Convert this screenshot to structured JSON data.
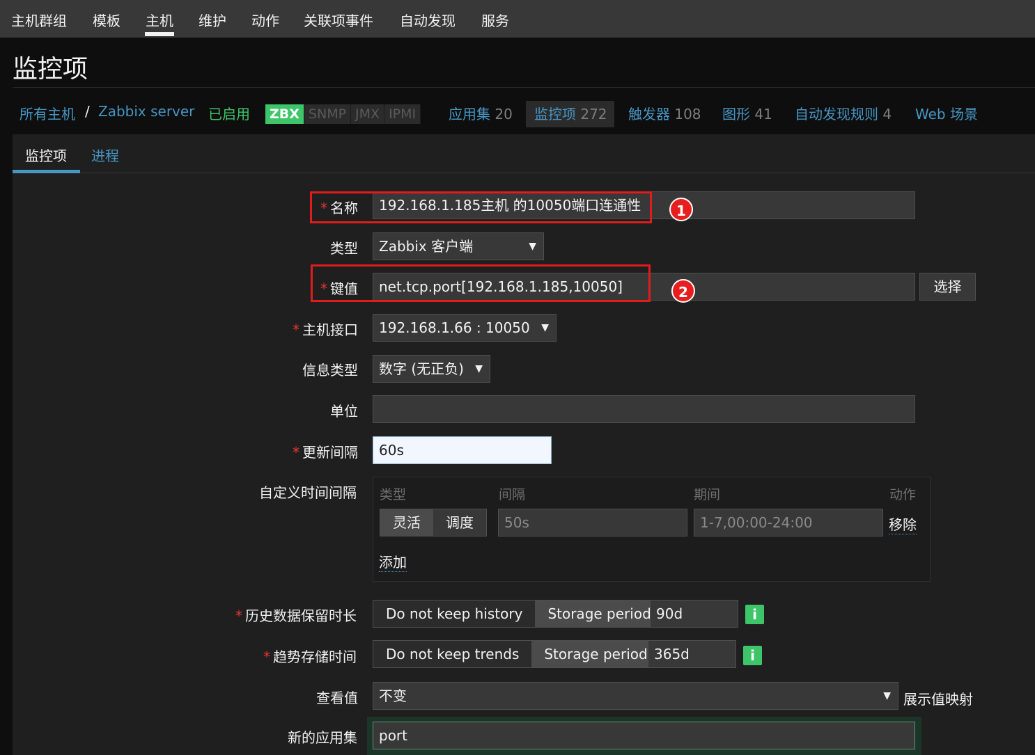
{
  "nav": {
    "items": [
      "主机群组",
      "模板",
      "主机",
      "维护",
      "动作",
      "关联项事件",
      "自动发现",
      "服务"
    ]
  },
  "page_title": "监控项",
  "breadcrumb": {
    "all_hosts": "所有主机",
    "separator": "/",
    "host": "Zabbix server",
    "status": "已启用",
    "protocols": [
      "ZBX",
      "SNMP",
      "JMX",
      "IPMI"
    ],
    "apps_label": "应用集",
    "apps_count": "20",
    "items_label": "监控项",
    "items_count": "272",
    "triggers_label": "触发器",
    "triggers_count": "108",
    "graphs_label": "图形",
    "graphs_count": "41",
    "discovery_label": "自动发现规则",
    "discovery_count": "4",
    "web_label": "Web 场景"
  },
  "tabs": [
    "监控项",
    "进程"
  ],
  "form": {
    "name_label": "名称",
    "name_value": "192.168.1.185主机 的10050端口连通性",
    "type_label": "类型",
    "type_value": "Zabbix 客户端",
    "key_label": "键值",
    "key_value": "net.tcp.port[192.168.1.185,10050]",
    "select_button": "选择",
    "interface_label": "主机接口",
    "interface_value": "192.168.1.66 : 10050",
    "info_type_label": "信息类型",
    "info_type_value": "数字 (无正负)",
    "units_label": "单位",
    "units_value": "",
    "interval_label": "更新间隔",
    "interval_value": "60s",
    "custom_label": "自定义时间间隔",
    "custom": {
      "col_type": "类型",
      "col_interval": "间隔",
      "col_period": "期间",
      "col_action": "动作",
      "flexible": "灵活",
      "scheduling": "调度",
      "interval_value": "50s",
      "period_value": "1-7,00:00-24:00",
      "remove": "移除",
      "add": "添加"
    },
    "history_label": "历史数据保留时长",
    "history_no_keep": "Do not keep history",
    "history_storage": "Storage period",
    "history_value": "90d",
    "trends_label": "趋势存储时间",
    "trends_no_keep": "Do not keep trends",
    "trends_storage": "Storage period",
    "trends_value": "365d",
    "info_icon": "i",
    "valuemap_label": "查看值",
    "valuemap_value": "不变",
    "valuemap_link": "展示值映射",
    "new_app_label": "新的应用集",
    "new_app_value": "port"
  },
  "annotations": {
    "badge1": "1",
    "badge2": "2",
    "box_color": "#e01c1c"
  },
  "colors": {
    "accent_link": "#4796c4",
    "enabled_green": "#3ec56a",
    "required_red": "#e33734"
  }
}
